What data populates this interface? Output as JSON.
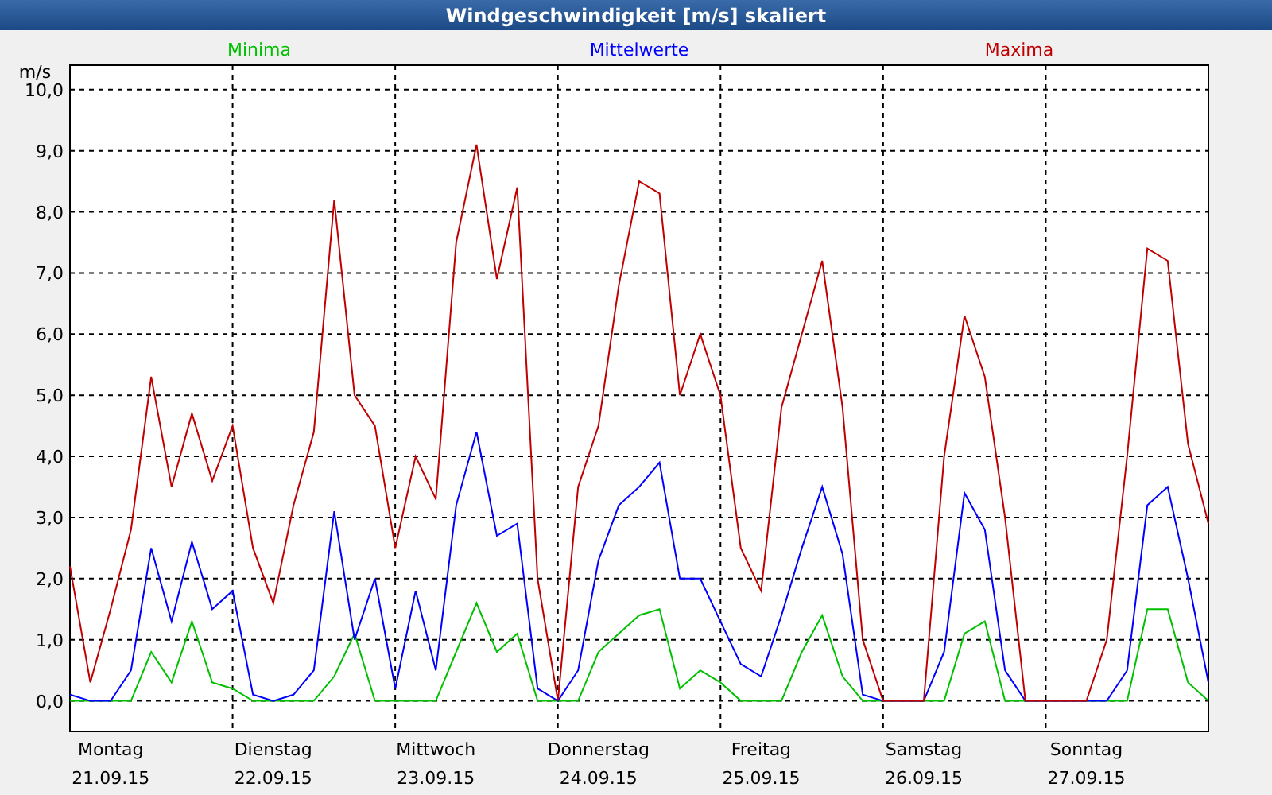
{
  "window": {
    "title": "Windgeschwindigkeit [m/s] skaliert"
  },
  "chart": {
    "chart_data": {
      "type": "line",
      "ylabel": "m/s",
      "categories": [
        null,
        null,
        "Montag",
        null,
        null,
        null,
        null,
        null,
        null,
        null,
        "Dienstag",
        null,
        null,
        null,
        null,
        null,
        null,
        null,
        "Mittwoch",
        null,
        null,
        null,
        null,
        null,
        null,
        null,
        "Donnerstag",
        null,
        null,
        null,
        null,
        null,
        null,
        null,
        "Freitag",
        null,
        null,
        null,
        null,
        null,
        null,
        null,
        "Samstag",
        null,
        null,
        null,
        null,
        null,
        null,
        null,
        "Sonntag",
        null,
        null,
        null,
        null,
        null,
        null
      ],
      "ylim": [
        -0.5,
        10.4
      ],
      "grid": true,
      "yticks": [
        {
          "value": 0,
          "label": "0,0"
        },
        {
          "value": 1,
          "label": "1,0"
        },
        {
          "value": 2,
          "label": "2,0"
        },
        {
          "value": 3,
          "label": "3,0"
        },
        {
          "value": 4,
          "label": "4,0"
        },
        {
          "value": 5,
          "label": "5,0"
        },
        {
          "value": 6,
          "label": "6,0"
        },
        {
          "value": 7,
          "label": "7,0"
        },
        {
          "value": 8,
          "label": "8,0"
        },
        {
          "value": 9,
          "label": "9,0"
        },
        {
          "value": 10,
          "label": "10,0"
        }
      ],
      "series": [
        {
          "name": "Minima",
          "color": "#00c000",
          "values": [
            0,
            0,
            0,
            0,
            0.8,
            0.3,
            1.3,
            0.3,
            0.2,
            0,
            0,
            0,
            0,
            0.4,
            1.1,
            0,
            0,
            0,
            0,
            0.8,
            1.6,
            0.8,
            1.1,
            0,
            0,
            0,
            0.8,
            1.1,
            1.4,
            1.5,
            0.2,
            0.5,
            0.3,
            0,
            0,
            0,
            0.8,
            1.4,
            0.4,
            0,
            0,
            0,
            0,
            0,
            1.1,
            1.3,
            0,
            0,
            0,
            0,
            0,
            0,
            0,
            1.5,
            1.5,
            0.3,
            0
          ]
        },
        {
          "name": "Mittelwerte",
          "color": "#0000ff",
          "values": [
            0.1,
            0,
            0,
            0.5,
            2.5,
            1.3,
            2.6,
            1.5,
            1.8,
            0.1,
            0,
            0.1,
            0.5,
            3.1,
            1,
            2,
            0.2,
            1.8,
            0.5,
            3.2,
            4.4,
            2.7,
            2.9,
            0.2,
            0,
            0.5,
            2.3,
            3.2,
            3.5,
            3.9,
            2,
            2,
            1.3,
            0.6,
            0.4,
            1.4,
            2.5,
            3.5,
            2.4,
            0.1,
            0,
            0,
            0,
            0.8,
            3.4,
            2.8,
            0.5,
            0,
            0,
            0,
            0,
            0,
            0.5,
            3.2,
            3.5,
            2,
            0.3
          ]
        },
        {
          "name": "Maxima",
          "color": "#c00000",
          "values": [
            2.2,
            0.3,
            1.5,
            2.8,
            5.3,
            3.5,
            4.7,
            3.6,
            4.5,
            2.5,
            1.6,
            3.2,
            4.4,
            8.2,
            5,
            4.5,
            2.5,
            4,
            3.3,
            7.5,
            9.1,
            6.9,
            8.4,
            2,
            0,
            3.5,
            4.5,
            6.8,
            8.5,
            8.3,
            5,
            6,
            5,
            2.5,
            1.8,
            4.8,
            6,
            7.2,
            4.8,
            1,
            0,
            0,
            0,
            4,
            6.3,
            5.3,
            3,
            0,
            0,
            0,
            0,
            1,
            4,
            7.4,
            7.2,
            4.2,
            2.9
          ]
        }
      ]
    },
    "dates": [
      "21.09.15",
      "22.09.15",
      "23.09.15",
      "24.09.15",
      "25.09.15",
      "26.09.15",
      "27.09.15"
    ]
  }
}
